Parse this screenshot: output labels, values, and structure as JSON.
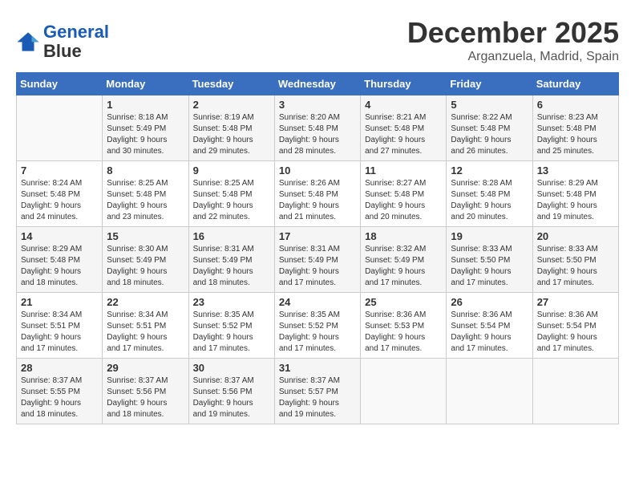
{
  "header": {
    "logo_line1": "General",
    "logo_line2": "Blue",
    "month": "December 2025",
    "location": "Arganzuela, Madrid, Spain"
  },
  "weekdays": [
    "Sunday",
    "Monday",
    "Tuesday",
    "Wednesday",
    "Thursday",
    "Friday",
    "Saturday"
  ],
  "weeks": [
    [
      {
        "day": "",
        "info": ""
      },
      {
        "day": "1",
        "info": "Sunrise: 8:18 AM\nSunset: 5:49 PM\nDaylight: 9 hours\nand 30 minutes."
      },
      {
        "day": "2",
        "info": "Sunrise: 8:19 AM\nSunset: 5:48 PM\nDaylight: 9 hours\nand 29 minutes."
      },
      {
        "day": "3",
        "info": "Sunrise: 8:20 AM\nSunset: 5:48 PM\nDaylight: 9 hours\nand 28 minutes."
      },
      {
        "day": "4",
        "info": "Sunrise: 8:21 AM\nSunset: 5:48 PM\nDaylight: 9 hours\nand 27 minutes."
      },
      {
        "day": "5",
        "info": "Sunrise: 8:22 AM\nSunset: 5:48 PM\nDaylight: 9 hours\nand 26 minutes."
      },
      {
        "day": "6",
        "info": "Sunrise: 8:23 AM\nSunset: 5:48 PM\nDaylight: 9 hours\nand 25 minutes."
      }
    ],
    [
      {
        "day": "7",
        "info": "Sunrise: 8:24 AM\nSunset: 5:48 PM\nDaylight: 9 hours\nand 24 minutes."
      },
      {
        "day": "8",
        "info": "Sunrise: 8:25 AM\nSunset: 5:48 PM\nDaylight: 9 hours\nand 23 minutes."
      },
      {
        "day": "9",
        "info": "Sunrise: 8:25 AM\nSunset: 5:48 PM\nDaylight: 9 hours\nand 22 minutes."
      },
      {
        "day": "10",
        "info": "Sunrise: 8:26 AM\nSunset: 5:48 PM\nDaylight: 9 hours\nand 21 minutes."
      },
      {
        "day": "11",
        "info": "Sunrise: 8:27 AM\nSunset: 5:48 PM\nDaylight: 9 hours\nand 20 minutes."
      },
      {
        "day": "12",
        "info": "Sunrise: 8:28 AM\nSunset: 5:48 PM\nDaylight: 9 hours\nand 20 minutes."
      },
      {
        "day": "13",
        "info": "Sunrise: 8:29 AM\nSunset: 5:48 PM\nDaylight: 9 hours\nand 19 minutes."
      }
    ],
    [
      {
        "day": "14",
        "info": "Sunrise: 8:29 AM\nSunset: 5:48 PM\nDaylight: 9 hours\nand 18 minutes."
      },
      {
        "day": "15",
        "info": "Sunrise: 8:30 AM\nSunset: 5:49 PM\nDaylight: 9 hours\nand 18 minutes."
      },
      {
        "day": "16",
        "info": "Sunrise: 8:31 AM\nSunset: 5:49 PM\nDaylight: 9 hours\nand 18 minutes."
      },
      {
        "day": "17",
        "info": "Sunrise: 8:31 AM\nSunset: 5:49 PM\nDaylight: 9 hours\nand 17 minutes."
      },
      {
        "day": "18",
        "info": "Sunrise: 8:32 AM\nSunset: 5:49 PM\nDaylight: 9 hours\nand 17 minutes."
      },
      {
        "day": "19",
        "info": "Sunrise: 8:33 AM\nSunset: 5:50 PM\nDaylight: 9 hours\nand 17 minutes."
      },
      {
        "day": "20",
        "info": "Sunrise: 8:33 AM\nSunset: 5:50 PM\nDaylight: 9 hours\nand 17 minutes."
      }
    ],
    [
      {
        "day": "21",
        "info": "Sunrise: 8:34 AM\nSunset: 5:51 PM\nDaylight: 9 hours\nand 17 minutes."
      },
      {
        "day": "22",
        "info": "Sunrise: 8:34 AM\nSunset: 5:51 PM\nDaylight: 9 hours\nand 17 minutes."
      },
      {
        "day": "23",
        "info": "Sunrise: 8:35 AM\nSunset: 5:52 PM\nDaylight: 9 hours\nand 17 minutes."
      },
      {
        "day": "24",
        "info": "Sunrise: 8:35 AM\nSunset: 5:52 PM\nDaylight: 9 hours\nand 17 minutes."
      },
      {
        "day": "25",
        "info": "Sunrise: 8:36 AM\nSunset: 5:53 PM\nDaylight: 9 hours\nand 17 minutes."
      },
      {
        "day": "26",
        "info": "Sunrise: 8:36 AM\nSunset: 5:54 PM\nDaylight: 9 hours\nand 17 minutes."
      },
      {
        "day": "27",
        "info": "Sunrise: 8:36 AM\nSunset: 5:54 PM\nDaylight: 9 hours\nand 17 minutes."
      }
    ],
    [
      {
        "day": "28",
        "info": "Sunrise: 8:37 AM\nSunset: 5:55 PM\nDaylight: 9 hours\nand 18 minutes."
      },
      {
        "day": "29",
        "info": "Sunrise: 8:37 AM\nSunset: 5:56 PM\nDaylight: 9 hours\nand 18 minutes."
      },
      {
        "day": "30",
        "info": "Sunrise: 8:37 AM\nSunset: 5:56 PM\nDaylight: 9 hours\nand 19 minutes."
      },
      {
        "day": "31",
        "info": "Sunrise: 8:37 AM\nSunset: 5:57 PM\nDaylight: 9 hours\nand 19 minutes."
      },
      {
        "day": "",
        "info": ""
      },
      {
        "day": "",
        "info": ""
      },
      {
        "day": "",
        "info": ""
      }
    ]
  ]
}
